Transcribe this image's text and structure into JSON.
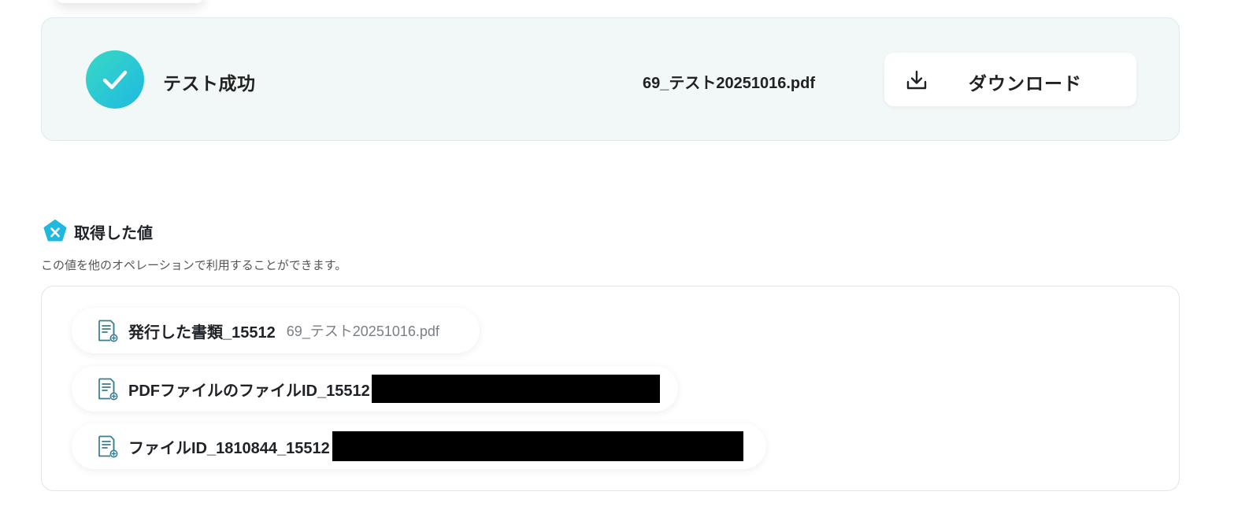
{
  "result": {
    "status_label": "テスト成功",
    "file_name": "69_テスト20251016.pdf",
    "download_label": "ダウンロード"
  },
  "obtained_values": {
    "title": "取得した値",
    "description": "この値を他のオペレーションで利用することができます。",
    "items": [
      {
        "label": "発行した書類_15512",
        "value": "69_テスト20251016.pdf",
        "redacted": false
      },
      {
        "label": "PDFファイルのファイルID_15512",
        "value": "",
        "redacted": true
      },
      {
        "label": "ファイルID_1810844_15512",
        "value": "",
        "redacted": true
      }
    ]
  },
  "colors": {
    "accent_gradient_start": "#38d9c5",
    "accent_gradient_end": "#1fb9e0",
    "section_icon": "#1fb9e0",
    "result_card_bg": "#f2f8f8"
  },
  "icons": {
    "success": "check-icon",
    "download": "download-icon",
    "section": "pentagon-x-icon",
    "value_item": "document-icon"
  }
}
